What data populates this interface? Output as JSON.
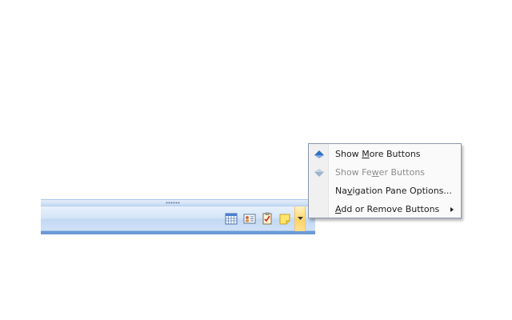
{
  "menu": {
    "items": [
      {
        "pre": "Show ",
        "key": "M",
        "post": "ore Buttons",
        "icon": "arrow-up-icon",
        "enabled": true
      },
      {
        "pre": "Show Fe",
        "key": "w",
        "post": "er Buttons",
        "icon": "arrow-down-icon",
        "enabled": false
      },
      {
        "pre": "Na",
        "key": "v",
        "post": "igation Pane Options...",
        "icon": "",
        "enabled": true
      },
      {
        "pre": "",
        "key": "A",
        "post": "dd or Remove Buttons",
        "icon": "",
        "enabled": true,
        "has_submenu": true
      }
    ]
  },
  "nav_pane": {
    "buttons": [
      {
        "icon": "calendar-icon"
      },
      {
        "icon": "contacts-icon"
      },
      {
        "icon": "tasks-icon"
      },
      {
        "icon": "notes-icon"
      },
      {
        "icon": "configure-buttons-icon"
      }
    ]
  },
  "colors": {
    "menu_icon_blue": "#3f7fd0",
    "menu_icon_disabled": "#9fb3cb",
    "strip_light": "#e8f1fc",
    "strip_dark": "#c3d9f3",
    "hover_yellow": "#ffd469"
  }
}
